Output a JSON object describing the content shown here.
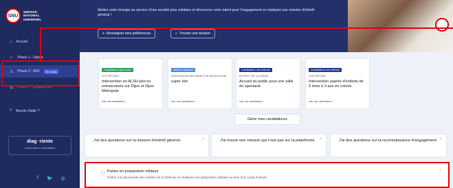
{
  "sidebar": {
    "logo_short": "SNU",
    "logo_text": "SERVICE NATIONAL UNIVERSEL",
    "items": [
      {
        "icon": "⌂",
        "label": "Accueil"
      },
      {
        "icon": "⚐",
        "label": "Phase 1 - Séjour"
      },
      {
        "icon": "♙",
        "label": "Phase 2 - MIG",
        "badge": "En cours"
      },
      {
        "icon": "◎",
        "label": "Phase 3 - Engagement"
      },
      {
        "icon": "?",
        "label": "Besoin d'aide ?"
      }
    ],
    "diag_title": "diag ·riente",
    "diag_sub": "Outil d'aide à l'orientation",
    "socials": [
      "f",
      "🐦",
      "◎"
    ]
  },
  "hero": {
    "text": "Mettez votre énergie au service d'une société plus solidaire et découvrez votre talent pour l'engagement en réalisant une mission d'intérêt général !",
    "btn1": "Renseigner mes préférences",
    "btn2": "Trouver une mission"
  },
  "cards": [
    {
      "badge": "Candidature approuvée",
      "badge_color": "#2ca05a",
      "org": "LES PEPCB91",
      "title": "Intervention en ALSH péri ou extrascolaire sur Dijon et Dijon Métropole",
      "link": "Voir ma candidature ›"
    },
    {
      "badge": "Mission effectuée",
      "badge_color": "#4a8ad6",
      "org": "ASSOCIATION DES BEBES DE BOURGOGNE",
      "title": "super lolo",
      "link": "Voir ma candidature ›"
    },
    {
      "badge": "Candidature non retenue",
      "badge_color": "#1f3a8a",
      "org": "BISTROT DE LA SCÈNE",
      "title": "Accueil du public pour une salle de spectacle",
      "link": "Voir ma candidature ›"
    },
    {
      "badge": "Candidature non retenue",
      "badge_color": "#1f3a8a",
      "org": "LES PEPCB91",
      "title": "Intervention auprès d'enfants de 2 mois à 3 ans en crèche",
      "link": "Voir ma candidature ›"
    }
  ],
  "manage_label": "Gérer mes candidatures",
  "questions": [
    "J'ai des questions sur la mission d'intérêt général",
    "J'ai trouvé une mission qui n'est pas sur la plateforme",
    "J'ai des questions sur la reconnaissance d'engagement"
  ],
  "prep": {
    "title": "Partez en préparation militaire",
    "sub": "Partez à la découverte des métiers de la Défense en réalisant une préparation militaire au sein d'un corps d'armée."
  },
  "highlight_color": "#e1000f"
}
